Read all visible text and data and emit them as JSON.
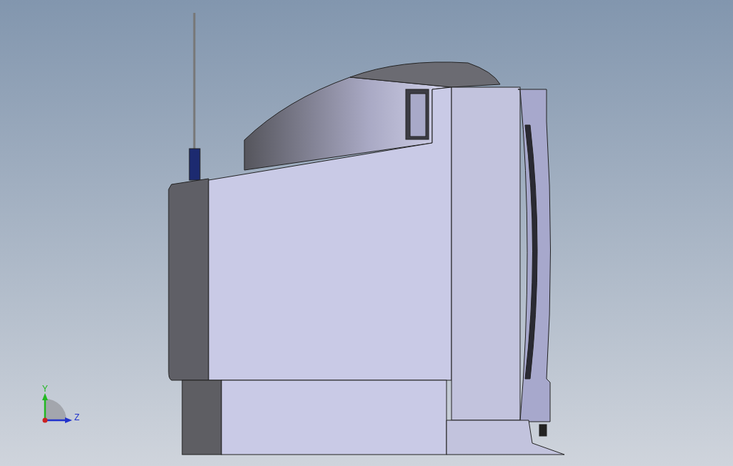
{
  "viewport": {
    "triad": {
      "axes": [
        {
          "label": "Y",
          "kind": "vertical",
          "color": "#22b822"
        },
        {
          "label": "Z",
          "kind": "horizontal",
          "color": "#2233cc"
        }
      ]
    }
  }
}
